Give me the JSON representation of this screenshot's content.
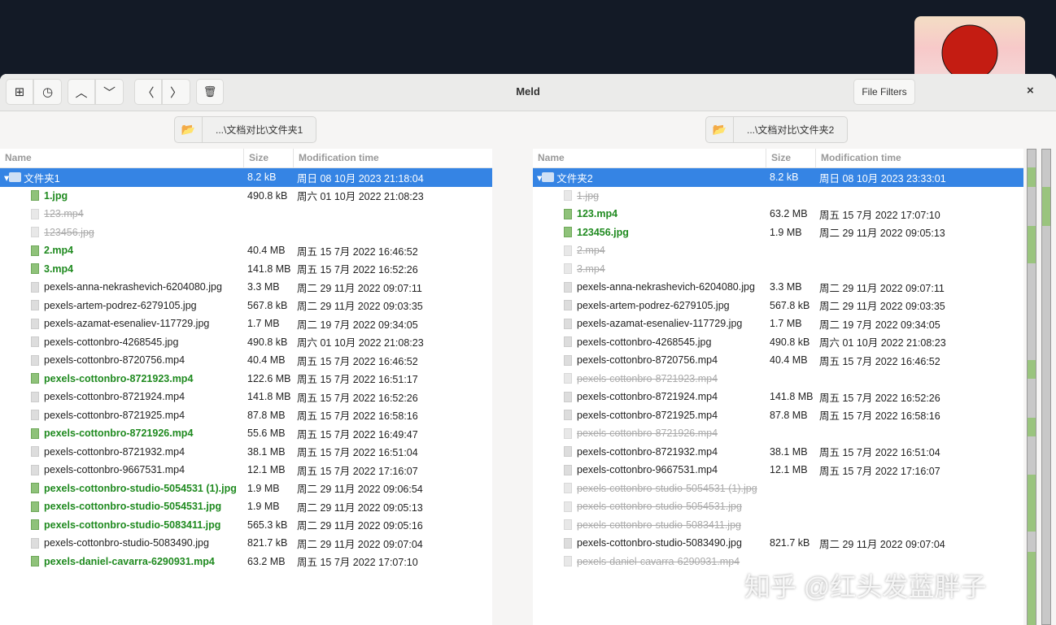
{
  "window": {
    "title": "Meld",
    "file_filters": "File Filters",
    "close": "×"
  },
  "toolbar": {
    "new": "⊞",
    "recent": "◷",
    "up": "︿",
    "down": "﹀",
    "prev": "〈",
    "next": "〉",
    "delete": "🗑"
  },
  "left": {
    "path": "...\\文档对比\\文件夹1",
    "headers": [
      "Name",
      "Size",
      "Modification time"
    ],
    "root": {
      "name": "文件夹1",
      "size": "8.2 kB",
      "time": "周日 08 10月 2023 21:18:04"
    },
    "rows": [
      [
        "1.jpg",
        "490.8 kB",
        "周六 01 10月 2022 21:08:23",
        "new"
      ],
      [
        "123.mp4",
        "",
        "",
        "miss"
      ],
      [
        "123456.jpg",
        "",
        "",
        "miss"
      ],
      [
        "2.mp4",
        "40.4 MB",
        "周五 15 7月 2022 16:46:52",
        "new"
      ],
      [
        "3.mp4",
        "141.8 MB",
        "周五 15 7月 2022 16:52:26",
        "new"
      ],
      [
        "pexels-anna-nekrashevich-6204080.jpg",
        "3.3 MB",
        "周二 29 11月 2022 09:07:11",
        ""
      ],
      [
        "pexels-artem-podrez-6279105.jpg",
        "567.8 kB",
        "周二 29 11月 2022 09:03:35",
        ""
      ],
      [
        "pexels-azamat-esenaliev-117729.jpg",
        "1.7 MB",
        "周二 19 7月 2022 09:34:05",
        ""
      ],
      [
        "pexels-cottonbro-4268545.jpg",
        "490.8 kB",
        "周六 01 10月 2022 21:08:23",
        ""
      ],
      [
        "pexels-cottonbro-8720756.mp4",
        "40.4 MB",
        "周五 15 7月 2022 16:46:52",
        ""
      ],
      [
        "pexels-cottonbro-8721923.mp4",
        "122.6 MB",
        "周五 15 7月 2022 16:51:17",
        "new"
      ],
      [
        "pexels-cottonbro-8721924.mp4",
        "141.8 MB",
        "周五 15 7月 2022 16:52:26",
        ""
      ],
      [
        "pexels-cottonbro-8721925.mp4",
        "87.8 MB",
        "周五 15 7月 2022 16:58:16",
        ""
      ],
      [
        "pexels-cottonbro-8721926.mp4",
        "55.6 MB",
        "周五 15 7月 2022 16:49:47",
        "new"
      ],
      [
        "pexels-cottonbro-8721932.mp4",
        "38.1 MB",
        "周五 15 7月 2022 16:51:04",
        ""
      ],
      [
        "pexels-cottonbro-9667531.mp4",
        "12.1 MB",
        "周五 15 7月 2022 17:16:07",
        ""
      ],
      [
        "pexels-cottonbro-studio-5054531 (1).jpg",
        "1.9 MB",
        "周二 29 11月 2022 09:06:54",
        "new"
      ],
      [
        "pexels-cottonbro-studio-5054531.jpg",
        "1.9 MB",
        "周二 29 11月 2022 09:05:13",
        "new"
      ],
      [
        "pexels-cottonbro-studio-5083411.jpg",
        "565.3 kB",
        "周二 29 11月 2022 09:05:16",
        "new"
      ],
      [
        "pexels-cottonbro-studio-5083490.jpg",
        "821.7 kB",
        "周二 29 11月 2022 09:07:04",
        ""
      ],
      [
        "pexels-daniel-cavarra-6290931.mp4",
        "63.2 MB",
        "周五 15 7月 2022 17:07:10",
        "new"
      ]
    ]
  },
  "right": {
    "path": "...\\文档对比\\文件夹2",
    "headers": [
      "Name",
      "Size",
      "Modification time"
    ],
    "root": {
      "name": "文件夹2",
      "size": "8.2 kB",
      "time": "周日 08 10月 2023 23:33:01"
    },
    "rows": [
      [
        "1.jpg",
        "",
        "",
        "miss"
      ],
      [
        "123.mp4",
        "63.2 MB",
        "周五 15 7月 2022 17:07:10",
        "new"
      ],
      [
        "123456.jpg",
        "1.9 MB",
        "周二 29 11月 2022 09:05:13",
        "new"
      ],
      [
        "2.mp4",
        "",
        "",
        "miss"
      ],
      [
        "3.mp4",
        "",
        "",
        "miss"
      ],
      [
        "pexels-anna-nekrashevich-6204080.jpg",
        "3.3 MB",
        "周二 29 11月 2022 09:07:11",
        ""
      ],
      [
        "pexels-artem-podrez-6279105.jpg",
        "567.8 kB",
        "周二 29 11月 2022 09:03:35",
        ""
      ],
      [
        "pexels-azamat-esenaliev-117729.jpg",
        "1.7 MB",
        "周二 19 7月 2022 09:34:05",
        ""
      ],
      [
        "pexels-cottonbro-4268545.jpg",
        "490.8 kB",
        "周六 01 10月 2022 21:08:23",
        ""
      ],
      [
        "pexels-cottonbro-8720756.mp4",
        "40.4 MB",
        "周五 15 7月 2022 16:46:52",
        ""
      ],
      [
        "pexels-cottonbro-8721923.mp4",
        "",
        "",
        "miss"
      ],
      [
        "pexels-cottonbro-8721924.mp4",
        "141.8 MB",
        "周五 15 7月 2022 16:52:26",
        ""
      ],
      [
        "pexels-cottonbro-8721925.mp4",
        "87.8 MB",
        "周五 15 7月 2022 16:58:16",
        ""
      ],
      [
        "pexels-cottonbro-8721926.mp4",
        "",
        "",
        "miss"
      ],
      [
        "pexels-cottonbro-8721932.mp4",
        "38.1 MB",
        "周五 15 7月 2022 16:51:04",
        ""
      ],
      [
        "pexels-cottonbro-9667531.mp4",
        "12.1 MB",
        "周五 15 7月 2022 17:16:07",
        ""
      ],
      [
        "pexels-cottonbro-studio-5054531 (1).jpg",
        "",
        "",
        "miss"
      ],
      [
        "pexels-cottonbro-studio-5054531.jpg",
        "",
        "",
        "miss"
      ],
      [
        "pexels-cottonbro-studio-5083411.jpg",
        "",
        "",
        "miss"
      ],
      [
        "pexels-cottonbro-studio-5083490.jpg",
        "821.7 kB",
        "周二 29 11月 2022 09:07:04",
        ""
      ],
      [
        "pexels-daniel-cavarra-6290931.mp4",
        "",
        "",
        "miss"
      ]
    ]
  },
  "watermark": "知乎 @红头发蓝胖子",
  "colors": {
    "selection": "#3584e4",
    "new": "#1f8a1f",
    "map_green": "#9ac47e"
  }
}
